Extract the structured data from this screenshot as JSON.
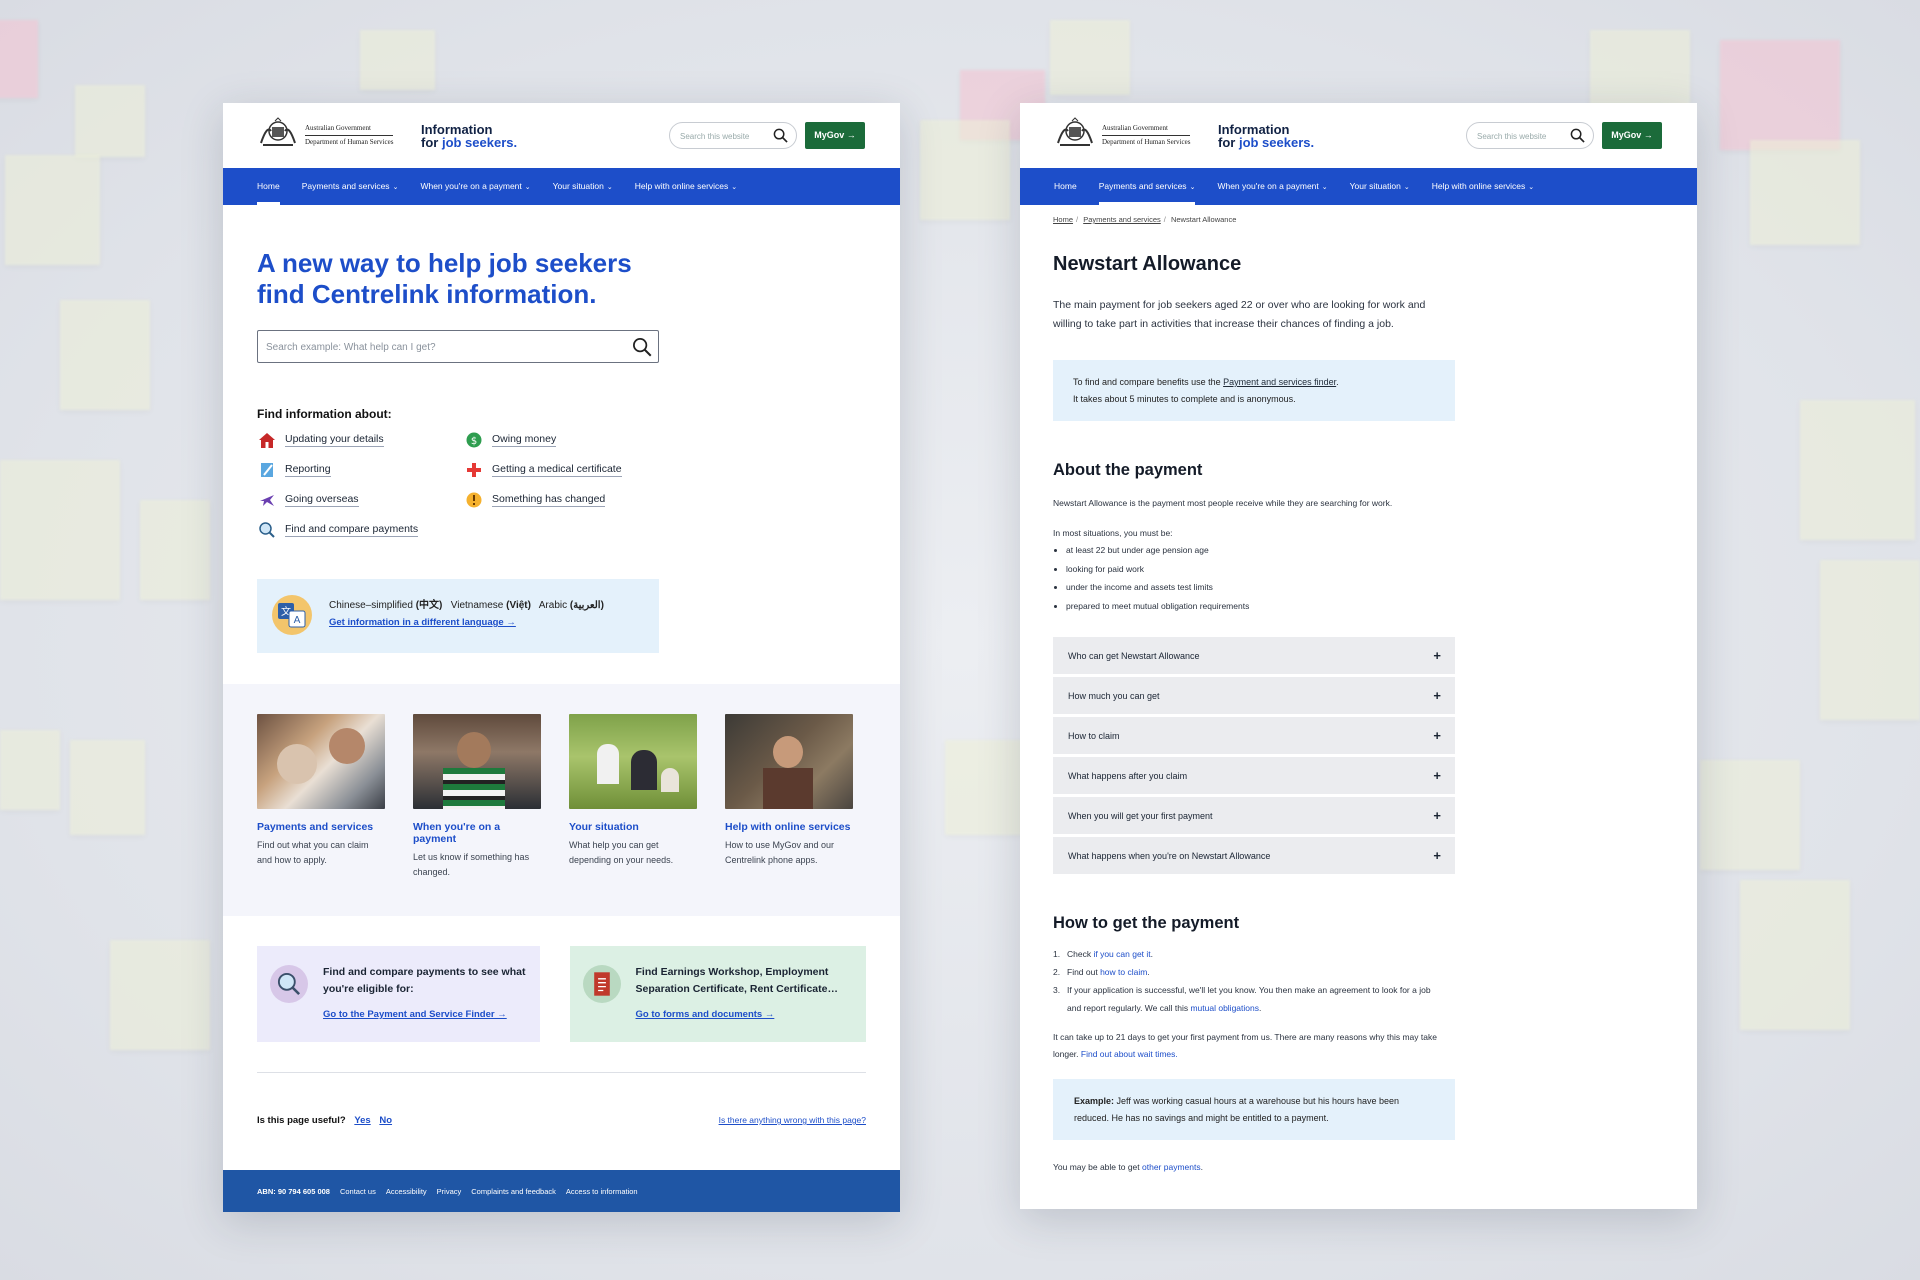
{
  "colors": {
    "primary_blue": "#1d4ec9",
    "mygov_green": "#1b6b3a",
    "footer_blue": "#1f56a5",
    "info_bg": "#e4f1fb"
  },
  "header": {
    "gov_line1": "Australian Government",
    "gov_line2": "Department of Human Services",
    "brand_line1": "Information",
    "brand_for": "for ",
    "brand_job": "job seekers.",
    "search_placeholder": "Search this website",
    "mygov_label": "MyGov →"
  },
  "nav": {
    "items": [
      {
        "label": "Home",
        "has_menu": false
      },
      {
        "label": "Payments and services",
        "has_menu": true
      },
      {
        "label": "When you're on a payment",
        "has_menu": true
      },
      {
        "label": "Your situation",
        "has_menu": true
      },
      {
        "label": "Help with online services",
        "has_menu": true
      }
    ]
  },
  "home": {
    "hero_title": "A new way to help job seekers find Centrelink information.",
    "search_placeholder": "Search example: What help can I get?",
    "find_heading": "Find information about:",
    "topics": [
      {
        "label": "Updating your details",
        "icon": "house-icon"
      },
      {
        "label": "Owing money",
        "icon": "money-icon"
      },
      {
        "label": "Reporting",
        "icon": "notepad-icon"
      },
      {
        "label": "Getting a medical certificate",
        "icon": "medical-cross-icon"
      },
      {
        "label": "Going overseas",
        "icon": "plane-icon"
      },
      {
        "label": "Something has changed",
        "icon": "alert-icon"
      },
      {
        "label": "Find and compare payments",
        "icon": "magnifier-icon"
      }
    ],
    "languages": {
      "chinese_label": "Chinese–simplified ",
      "chinese_native": "(中文)",
      "viet_label": "Vietnamese ",
      "viet_native": "(Việt)",
      "arabic_label": "Arabic ",
      "arabic_native": "(العربية)",
      "link": "Get information in a different language →"
    },
    "cards": [
      {
        "title": "Payments and services",
        "desc": "Find out what you can claim and how to apply."
      },
      {
        "title": "When you're on a payment",
        "desc": "Let us know if something has changed."
      },
      {
        "title": "Your situation",
        "desc": "What help you can get depending on your needs."
      },
      {
        "title": "Help with online services",
        "desc": "How to use MyGov and our Centrelink phone apps."
      }
    ],
    "promo": [
      {
        "text": "Find and compare payments to see what you're eligible for:",
        "link": "Go to the Payment and Service Finder →"
      },
      {
        "text": "Find Earnings Workshop, Employment Separation Certificate, Rent Certificate…",
        "link": "Go to forms and documents →"
      }
    ],
    "useful": {
      "question": "Is this page useful?",
      "yes": "Yes",
      "no": "No",
      "wrong": "Is there anything wrong with this page?"
    },
    "footer": {
      "abn": "ABN: 90 794 605 008",
      "links": [
        "Contact us",
        "Accessibility",
        "Privacy",
        "Complaints and feedback",
        "Access to information"
      ]
    }
  },
  "newstart": {
    "breadcrumb": [
      "Home",
      "Payments and services",
      "Newstart Allowance"
    ],
    "title": "Newstart Allowance",
    "lead": "The main payment for job seekers aged 22 or over who are looking for work and willing to take part in activities that increase their chances of finding a job.",
    "info_pre": "To find and compare benefits use the ",
    "info_link": "Payment and services finder",
    "info_post": ".",
    "info_line2": "It takes about 5 minutes to complete and is anonymous.",
    "about_heading": "About the payment",
    "about_text": "Newstart Allowance is the payment most people receive while they are searching for work.",
    "must_be": "In most situations, you must be:",
    "requirements": [
      "at least 22 but under age pension age",
      "looking for paid work",
      "under the income and assets test limits",
      "prepared to meet mutual obligation requirements"
    ],
    "accordion": [
      "Who can get Newstart Allowance",
      "How much you can get",
      "How to claim",
      "What happens after you claim",
      "When you will get your first payment",
      "What happens when you're on Newstart Allowance"
    ],
    "how_heading": "How to get the payment",
    "steps": [
      {
        "n": "1.",
        "pre": "Check ",
        "link": "if you can get it",
        "post": "."
      },
      {
        "n": "2.",
        "pre": "Find out ",
        "link": "how to claim",
        "post": "."
      },
      {
        "n": "3.",
        "pre": "If your application is successful, we'll let you know. You then make an agreement to look for a job and report regularly. We call this ",
        "link": "mutual obligations",
        "post": "."
      }
    ],
    "wait_text": "It can take up to 21 days to get your first payment from us. There are many reasons why this may take longer. ",
    "wait_link": "Find out about wait times.",
    "example_label": "Example:",
    "example_text": " Jeff was working casual hours at a warehouse but his hours have been reduced. He has no savings and might be entitled to a payment.",
    "other_pre": "You may be able to get ",
    "other_link": "other payments",
    "other_post": "."
  }
}
